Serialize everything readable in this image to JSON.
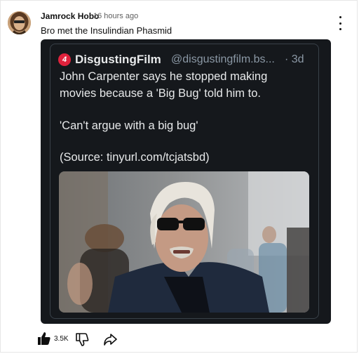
{
  "comment": {
    "author": "Jamrock Hobo",
    "timestamp": "16 hours ago",
    "text": "Bro met the Insulindian Phasmid",
    "avatar": "avatar"
  },
  "embed": {
    "source_icon": "disgustingfilm-logo-icon",
    "source_icon_letter": "4",
    "source_name": "DisgustingFilm",
    "handle": "@disgustingfilm.bs...",
    "time": "· 3d",
    "lines": [
      "John Carpenter says he stopped making",
      "movies because a 'Big Bug' told him to.",
      "'Can't argue with a big bug'",
      "(Source: tinyurl.com/tcjatsbd)"
    ],
    "image": "photo of elderly man with white hair and sunglasses"
  },
  "actions": {
    "like_count": "3.5K",
    "like_icon": "thumbs-up-icon",
    "dislike_icon": "thumbs-down-icon",
    "share_icon": "share-icon",
    "menu_icon": "more-vertical-icon"
  },
  "colors": {
    "embed_background": "#15181c",
    "source_icon": "#e0223c",
    "muted_text": "#8b98a5",
    "post_text": "#e7e9ea"
  }
}
